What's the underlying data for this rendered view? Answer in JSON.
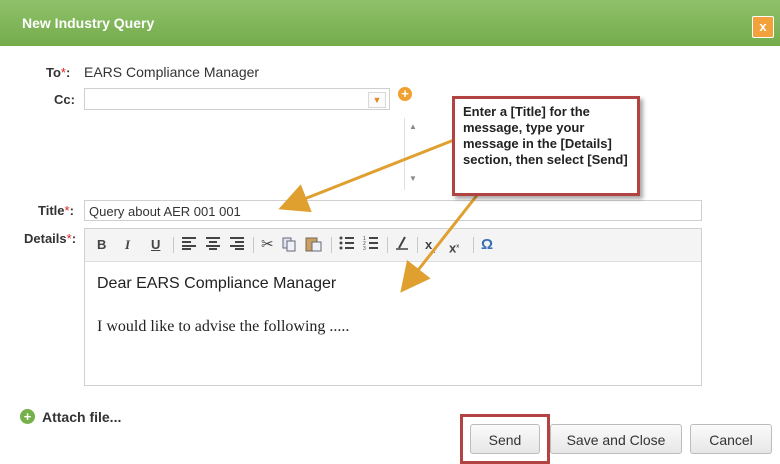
{
  "dialog": {
    "title": "New Industry Query",
    "close_label": "x"
  },
  "form": {
    "to_label": "To",
    "to_value": "EARS Compliance Manager",
    "cc_label": "Cc:",
    "cc_value": "",
    "title_label": "Title",
    "title_value": "Query about AER 001 001",
    "details_label": "Details",
    "required_marker": "*",
    "colon": ":"
  },
  "editor": {
    "toolbar": [
      "B",
      "I",
      "U",
      "align-left-icon",
      "align-center-icon",
      "align-right-icon",
      "cut-icon",
      "copy-icon",
      "paste-icon",
      "bulleted-list-icon",
      "numbered-list-icon",
      "remove-format-icon",
      "subscript-icon",
      "superscript-icon",
      "omega-icon"
    ],
    "line1": "Dear EARS Compliance Manager",
    "line2": "I would like to advise the following ....."
  },
  "callout": {
    "text": "Enter a [Title] for the message, type your message in the [Details] section, then select [Send]"
  },
  "attach_label": "Attach file...",
  "buttons": {
    "send": "Send",
    "save_close": "Save and Close",
    "cancel": "Cancel"
  },
  "colors": {
    "header": "#7db356",
    "accent": "#f3a13b",
    "highlight": "#b24343",
    "arrow": "#e0a030"
  }
}
